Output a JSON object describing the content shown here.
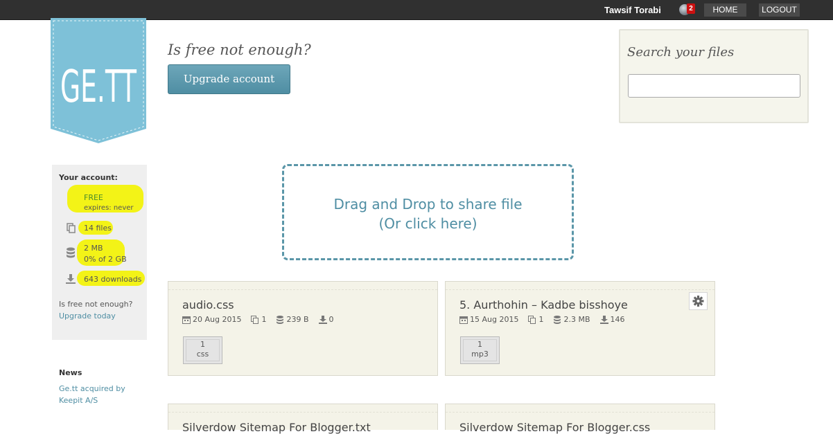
{
  "topbar": {
    "user_name": "Tawsif Torabi",
    "notification_count": "2",
    "home_label": "HOME",
    "logout_label": "LOGOUT"
  },
  "logo": {
    "text": "GE.TT",
    "color": "#7ec1d8"
  },
  "upsell": {
    "title": "Is free not enough?",
    "button_label": "Upgrade account"
  },
  "search": {
    "title": "Search your files",
    "placeholder": ""
  },
  "account": {
    "heading": "Your account:",
    "plan": "FREE",
    "expires": "expires: never",
    "files": "14 files",
    "storage_used": "2 MB",
    "storage_percent": "0% of 2 GB",
    "downloads": "643 downloads",
    "upsell_text": "Is free not enough?",
    "upgrade_link": "Upgrade today"
  },
  "news": {
    "heading": "News",
    "item": "Ge.tt acquired by Keepit A/S"
  },
  "dropzone": {
    "line1": "Drag and Drop to share file",
    "line2": "(Or click here)"
  },
  "files": [
    {
      "name": "audio.css",
      "date": "20 Aug 2015",
      "count": "1",
      "size": "239 B",
      "downloads": "0",
      "type_count": "1",
      "type": "css"
    },
    {
      "name": "5. Aurthohin – Kadbe bisshoye",
      "date": "15 Aug 2015",
      "count": "1",
      "size": "2.3 MB",
      "downloads": "146",
      "type_count": "1",
      "type": "mp3"
    },
    {
      "name": "Silverdow Sitemap For Blogger.txt"
    },
    {
      "name": "Silverdow Sitemap For Blogger.css"
    }
  ],
  "colors": {
    "accent": "#4f8ea3",
    "highlight": "#f3f317",
    "topbar": "#303030",
    "card": "#f4f3e8"
  }
}
